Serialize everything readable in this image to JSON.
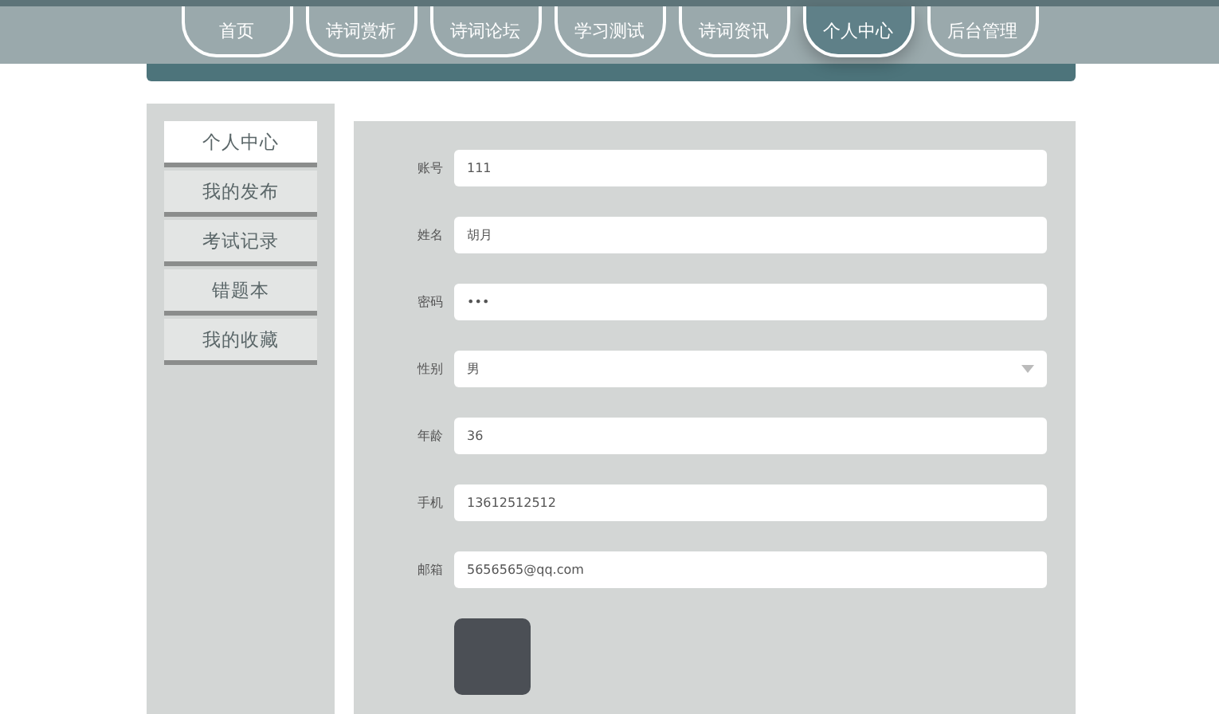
{
  "nav": [
    {
      "label": "首页",
      "selected": false
    },
    {
      "label": "诗词赏析",
      "selected": false
    },
    {
      "label": "诗词论坛",
      "selected": false
    },
    {
      "label": "学习测试",
      "selected": false
    },
    {
      "label": "诗词资讯",
      "selected": false
    },
    {
      "label": "个人中心",
      "selected": true
    },
    {
      "label": "后台管理",
      "selected": false
    }
  ],
  "sidebar": {
    "items": [
      {
        "label": "个人中心",
        "selected": true
      },
      {
        "label": "我的发布",
        "selected": false
      },
      {
        "label": "考试记录",
        "selected": false
      },
      {
        "label": "错题本",
        "selected": false
      },
      {
        "label": "我的收藏",
        "selected": false
      }
    ]
  },
  "form": {
    "fields": [
      {
        "kind": "text",
        "label": "账号",
        "value": "111"
      },
      {
        "kind": "text",
        "label": "姓名",
        "value": "胡月"
      },
      {
        "kind": "text",
        "label": "密码",
        "value": "•••"
      },
      {
        "kind": "select",
        "label": "性别",
        "value": "男"
      },
      {
        "kind": "text",
        "label": "年龄",
        "value": "36"
      },
      {
        "kind": "text",
        "label": "手机",
        "value": "13612512512"
      },
      {
        "kind": "text",
        "label": "邮箱",
        "value": "5656565@qq.com"
      }
    ]
  }
}
